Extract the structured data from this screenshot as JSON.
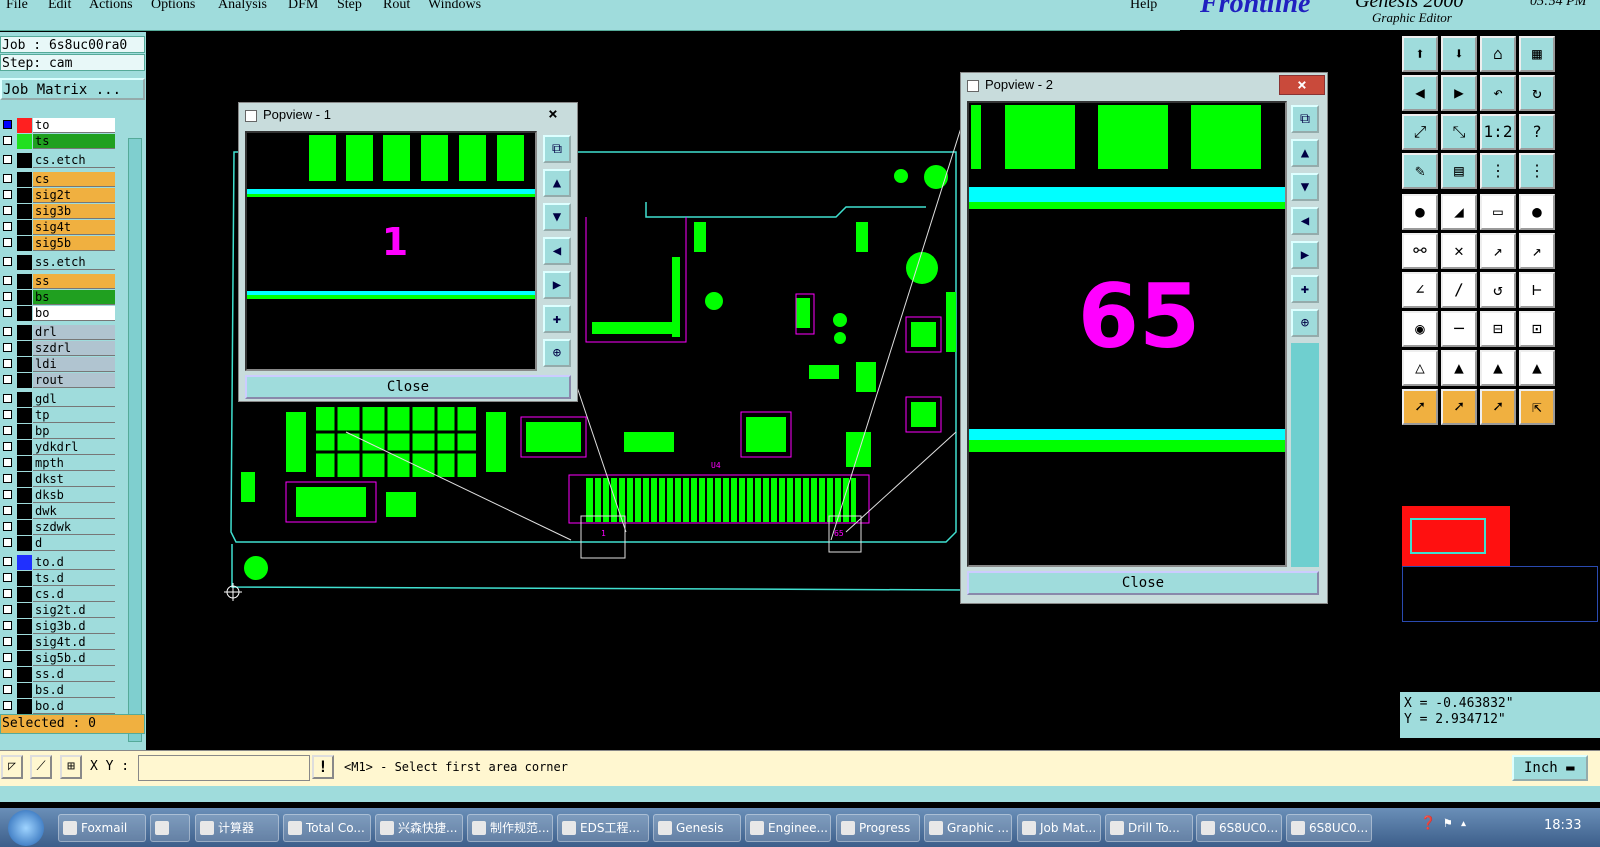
{
  "menu": {
    "items": [
      "File",
      "Edit",
      "Actions",
      "Options",
      "Analysis",
      "DFM",
      "Step",
      "Rout",
      "Windows"
    ],
    "help": "Help"
  },
  "branding": {
    "logo": "Frontline",
    "product": "Genesis 2000",
    "subtitle": "Graphic Editor",
    "clock": "05:54 PM"
  },
  "job": {
    "job_label": "Job : 6s8uc00ra0",
    "step_label": "Step: cam",
    "matrix_button": "Job Matrix ..."
  },
  "layers": [
    {
      "name": "to",
      "color": "#ffffff",
      "swatch": "#ff2020",
      "boxcolor": "#0000ff"
    },
    {
      "name": "ts",
      "color": "#20a020",
      "swatch": "#20e020"
    },
    {
      "name": "cs.etch",
      "color": "#9fdcdc"
    },
    {
      "name": "cs",
      "color": "#f0b040"
    },
    {
      "name": "sig2t",
      "color": "#f0b040"
    },
    {
      "name": "sig3b",
      "color": "#f0b040"
    },
    {
      "name": "sig4t",
      "color": "#f0b040"
    },
    {
      "name": "sig5b",
      "color": "#f0b040"
    },
    {
      "name": "ss.etch",
      "color": "#9fdcdc"
    },
    {
      "name": "ss",
      "color": "#f0b040"
    },
    {
      "name": "bs",
      "color": "#20a020"
    },
    {
      "name": "bo",
      "color": "#ffffff"
    },
    {
      "name": "drl",
      "color": "#b0c4d0"
    },
    {
      "name": "szdrl",
      "color": "#b0c4d0"
    },
    {
      "name": "ldi",
      "color": "#b0c4d0"
    },
    {
      "name": "rout",
      "color": "#b0c4d0"
    },
    {
      "name": "gdl",
      "color": "#9fdcdc"
    },
    {
      "name": "tp",
      "color": "#9fdcdc"
    },
    {
      "name": "bp",
      "color": "#9fdcdc"
    },
    {
      "name": "ydkdrl",
      "color": "#9fdcdc"
    },
    {
      "name": "mpth",
      "color": "#9fdcdc"
    },
    {
      "name": "dkst",
      "color": "#9fdcdc"
    },
    {
      "name": "dksb",
      "color": "#9fdcdc"
    },
    {
      "name": "dwk",
      "color": "#9fdcdc"
    },
    {
      "name": "szdwk",
      "color": "#9fdcdc"
    },
    {
      "name": "d",
      "color": "#9fdcdc"
    },
    {
      "name": "to.d",
      "color": "#9fdcdc",
      "swatch": "#2030ff"
    },
    {
      "name": "ts.d",
      "color": "#9fdcdc"
    },
    {
      "name": "cs.d",
      "color": "#9fdcdc"
    },
    {
      "name": "sig2t.d",
      "color": "#9fdcdc"
    },
    {
      "name": "sig3b.d",
      "color": "#9fdcdc"
    },
    {
      "name": "sig4t.d",
      "color": "#9fdcdc"
    },
    {
      "name": "sig5b.d",
      "color": "#9fdcdc"
    },
    {
      "name": "ss.d",
      "color": "#9fdcdc"
    },
    {
      "name": "bs.d",
      "color": "#9fdcdc"
    },
    {
      "name": "bo.d",
      "color": "#9fdcdc"
    }
  ],
  "selected_label": "Selected : 0",
  "popview1": {
    "title": "Popview - 1",
    "label": "1",
    "close": "Close"
  },
  "popview2": {
    "title": "Popview - 2",
    "label": "65",
    "close": "Close"
  },
  "board_labels": {
    "pin1": "1",
    "pin65": "65",
    "u4": "U4"
  },
  "coords": {
    "x": "X = -0.463832\"",
    "y": "Y = 2.934712\""
  },
  "cmd": {
    "xy_label": "X Y :",
    "xy_value": "",
    "prompt": "<M1> - Select first area corner",
    "units": "Inch"
  },
  "taskbar": {
    "tasks": [
      "Foxmail",
      "",
      "计算器",
      "Total Co...",
      "兴森快捷...",
      "制作规范...",
      "EDS工程...",
      "Genesis",
      "Enginee...",
      "Progress",
      "Graphic ...",
      "Job Mat...",
      "Drill To...",
      "6S8UC0...",
      "6S8UC0..."
    ],
    "time": "18:33"
  },
  "colors": {
    "panel": "#9fdcdc",
    "pad": "#00ff00",
    "silk": "#ff00ff",
    "outline": "#40e0d0",
    "accent": "#f0b040"
  }
}
